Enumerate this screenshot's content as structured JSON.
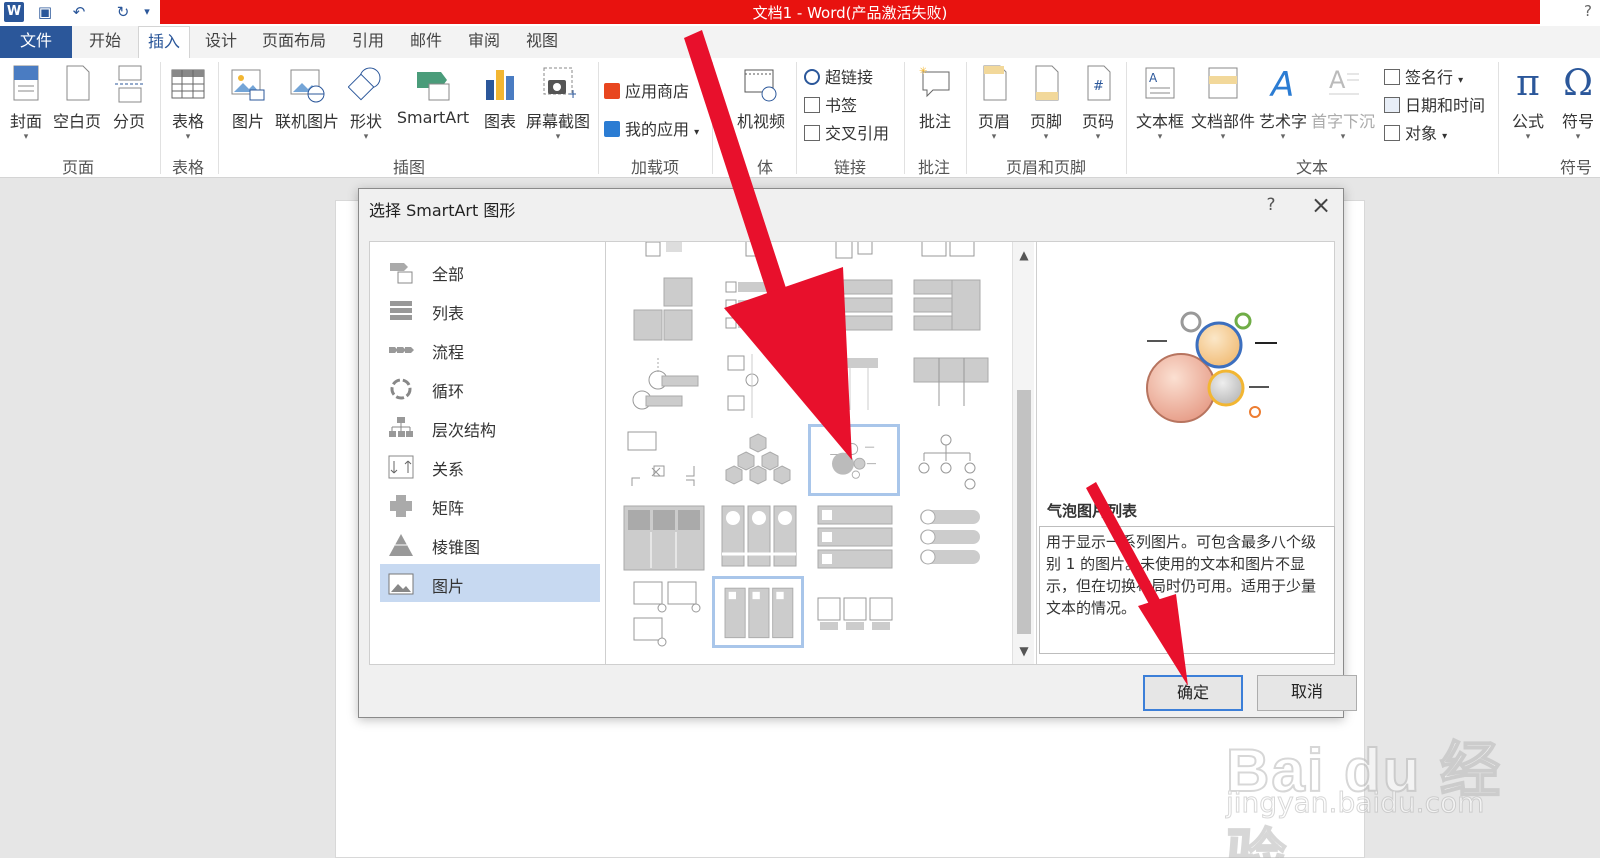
{
  "window": {
    "title": "文档1 -  Word(产品激活失败)",
    "help": "?"
  },
  "tabs": [
    "文件",
    "开始",
    "插入",
    "设计",
    "页面布局",
    "引用",
    "邮件",
    "审阅",
    "视图"
  ],
  "ribbon": {
    "pages": {
      "cover": "封面",
      "blank": "空白页",
      "break": "分页",
      "group": "页面"
    },
    "tables": {
      "table": "表格",
      "group": "表格"
    },
    "illustrations": {
      "picture": "图片",
      "online_picture": "联机图片",
      "shapes": "形状",
      "smartart": "SmartArt",
      "chart": "图表",
      "screenshot": "屏幕截图",
      "group": "插图"
    },
    "addins": {
      "store": "应用商店",
      "myapps": "我的应用",
      "group": "加载项"
    },
    "media": {
      "video": "机视频",
      "group": "体"
    },
    "links": {
      "hyperlink": "超链接",
      "bookmark": "书签",
      "crossref": "交叉引用",
      "group": "链接"
    },
    "comments": {
      "comment": "批注",
      "group": "批注"
    },
    "header_footer": {
      "header": "页眉",
      "footer": "页脚",
      "page_number": "页码",
      "group": "页眉和页脚"
    },
    "text": {
      "textbox": "文本框",
      "quickparts": "文档部件",
      "wordart": "艺术字",
      "dropcap": "首字下沉",
      "signature": "签名行",
      "datetime": "日期和时间",
      "object": "对象",
      "group": "文本"
    },
    "symbols": {
      "equation": "公式",
      "symbol": "符号",
      "group": "符号"
    }
  },
  "dialog": {
    "title": "选择 SmartArt 图形",
    "help": "?",
    "categories": [
      "全部",
      "列表",
      "流程",
      "循环",
      "层次结构",
      "关系",
      "矩阵",
      "棱锥图",
      "图片"
    ],
    "selected_category": "图片",
    "preview": {
      "name": "气泡图片列表",
      "description": "用于显示一系列图片。可包含最多八个级别 1 的图片。未使用的文本和图片不显示，但在切换布局时仍可用。适用于少量文本的情况。"
    },
    "ok": "确定",
    "cancel": "取消"
  },
  "watermark": {
    "brand": "Bai du 经验",
    "url": "jingyan.baidu.com"
  },
  "colors": {
    "title_red": "#e8120f",
    "word_blue": "#2b579a",
    "arrow_red": "#e8102c",
    "selection": "#c7d9f1"
  }
}
